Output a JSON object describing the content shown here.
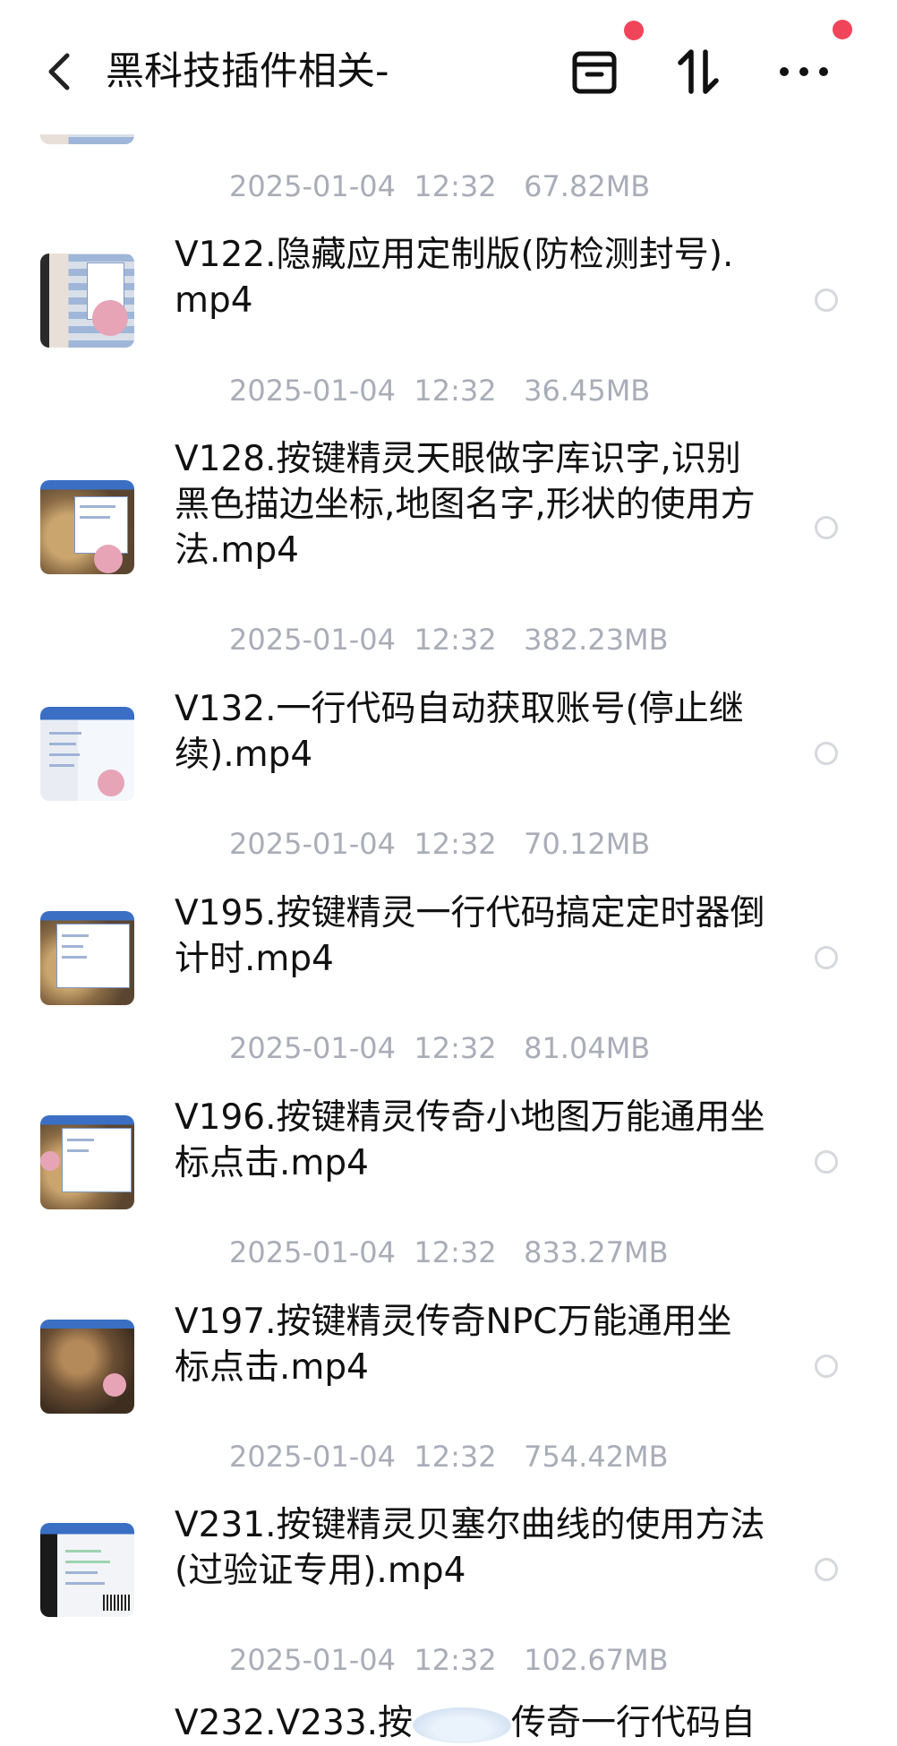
{
  "header": {
    "back_icon": "chevron-left-icon",
    "title": "黑科技插件相关-",
    "actions": [
      {
        "name": "archive-button",
        "icon": "archive-box-icon",
        "badge": true
      },
      {
        "name": "sort-button",
        "icon": "sort-arrows-icon",
        "badge": false
      },
      {
        "name": "more-button",
        "icon": "more-dots-icon",
        "badge": true
      }
    ],
    "badge_color": "#f0445a"
  },
  "files": [
    {
      "name": "",
      "date": "2025-01-04",
      "time": "12:32",
      "size": "67.82MB"
    },
    {
      "name": "V122.隐藏应用定制版(防检测封号).mp4",
      "date": "2025-01-04",
      "time": "12:32",
      "size": "36.45MB"
    },
    {
      "name": "V128.按键精灵天眼做字库识字,识别黑色描边坐标,地图名字,形状的使用方法.mp4",
      "date": "2025-01-04",
      "time": "12:32",
      "size": "382.23MB"
    },
    {
      "name": "V132.一行代码自动获取账号(停止继续).mp4",
      "date": "2025-01-04",
      "time": "12:32",
      "size": "70.12MB"
    },
    {
      "name": "V195.按键精灵一行代码搞定定时器倒计时.mp4",
      "date": "2025-01-04",
      "time": "12:32",
      "size": "81.04MB"
    },
    {
      "name": "V196.按键精灵传奇小地图万能通用坐标点击.mp4",
      "date": "2025-01-04",
      "time": "12:32",
      "size": "833.27MB"
    },
    {
      "name": "V197.按键精灵传奇NPC万能通用坐标点击.mp4",
      "date": "2025-01-04",
      "time": "12:32",
      "size": "754.42MB"
    },
    {
      "name": "V231.按键精灵贝塞尔曲线的使用方法(过验证专用).mp4",
      "date": "2025-01-04",
      "time": "12:32",
      "size": "102.67MB"
    },
    {
      "name": "V232.V233.按",
      "suffix": "传奇一行代码自",
      "date": "",
      "time": "",
      "size": ""
    }
  ],
  "colors": {
    "meta_text": "#a8adb8",
    "radio_border": "#d6d8dd"
  }
}
